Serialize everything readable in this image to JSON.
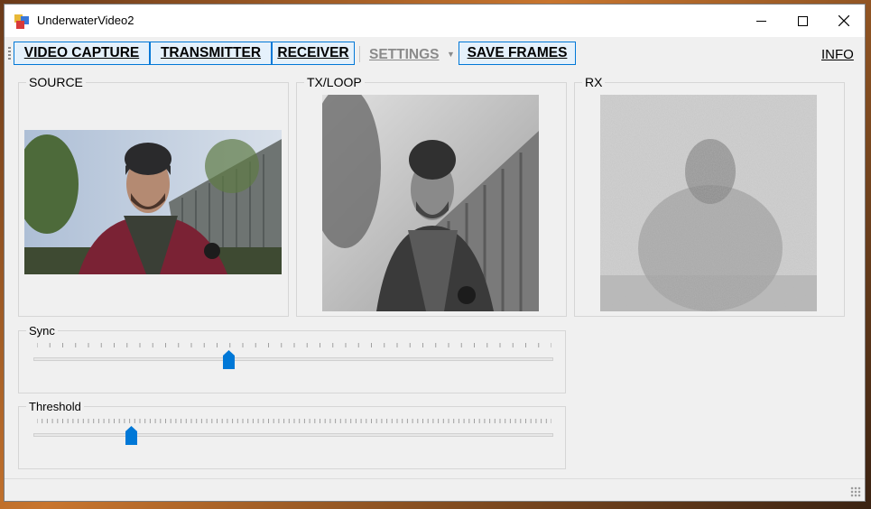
{
  "window": {
    "title": "UnderwaterVideo2"
  },
  "menu": {
    "video_capture": "VIDEO CAPTURE",
    "transmitter": "TRANSMITTER",
    "receiver": "RECEIVER",
    "settings": "SETTINGS",
    "save_frames": "SAVE FRAMES",
    "info": "INFO"
  },
  "panels": {
    "source": "SOURCE",
    "txloop": "TX/LOOP",
    "rx": "RX"
  },
  "sliders": {
    "sync": {
      "label": "Sync",
      "value_fraction": 0.376
    },
    "threshold": {
      "label": "Threshold",
      "value_fraction": 0.188
    }
  },
  "colors": {
    "accent": "#0078d7",
    "border": "#d6d6d6",
    "background": "#f0f0f0"
  }
}
